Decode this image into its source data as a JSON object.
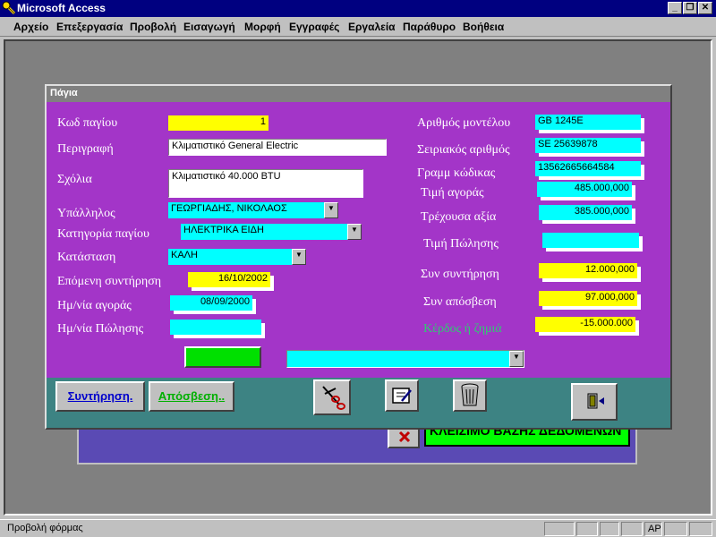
{
  "window": {
    "title": "Microsoft Access"
  },
  "menu": [
    "Αρχείο",
    "Επεξεργασία",
    "Προβολή",
    "Εισαγωγή",
    "Μορφή",
    "Εγγραφές",
    "Εργαλεία",
    "Παράθυρο",
    "Βοήθεια"
  ],
  "form": {
    "title": "Πάγια",
    "labels": {
      "code": "Κωδ παγίου",
      "description": "Περιγραφή",
      "notes": "Σχόλια",
      "employee": "Υπάλληλος",
      "category": "Κατηγορία παγίου",
      "status": "Κατάσταση",
      "next_maintenance": "Επόμενη συντήρηση",
      "purchase_date": "Ημ/νία αγοράς",
      "sale_date": "Ημ/νία Πώλησης",
      "model_number": "Αριθμός μοντέλου",
      "serial_number": "Σειριακός αριθμός",
      "barcode": "Γραμμ κώδικας",
      "purchase_price": "Τιμή αγοράς",
      "current_value": "Τρέχουσα αξία",
      "sale_price": "Τιμή Πώλησης",
      "total_maintenance": "Συν συντήρηση",
      "total_depreciation": "Συν απόσβεση",
      "profit_loss": "Κέρδος ή ζημιά"
    },
    "values": {
      "code": "1",
      "description": "Κλιματιστικό General Electric",
      "notes": "Κλιματιστικό 40.000 BTU",
      "employee": "ΓΕΩΡΓΙΑΔΗΣ, ΝΙΚΟΛΑΟΣ",
      "category": "ΗΛΕΚΤΡΙΚΑ ΕΙΔΗ",
      "status": "ΚΑΛΗ",
      "next_maintenance": "16/10/2002",
      "purchase_date": "08/09/2000",
      "sale_date": "",
      "model_number": "GB 1245E",
      "serial_number": "SE 25639878",
      "barcode": "13562665664584",
      "purchase_price": "485.000,000",
      "current_value": "385.000,000",
      "sale_price": "",
      "total_maintenance": "12.000,000",
      "total_depreciation": "97.000,000",
      "profit_loss": "-15.000.000",
      "search_combo": ""
    },
    "buttons": {
      "maintenance": "Συντήρηση.",
      "depreciation": "Απόσβεση.."
    }
  },
  "background_form": {
    "button_label": "ΚΛΕΙΣΙΜΟ ΒΑΣΗΣ ΔΕΔΟΜΕΝΩΝ"
  },
  "statusbar": {
    "text": "Προβολή φόρμας",
    "indicator": "ΑΡ"
  },
  "colors": {
    "form_bg": "#a335c8",
    "footer_bg": "#3d8383",
    "yellow_field": "#ffff00",
    "cyan_field": "#00ffff",
    "profit_label": "#2ecc71"
  }
}
